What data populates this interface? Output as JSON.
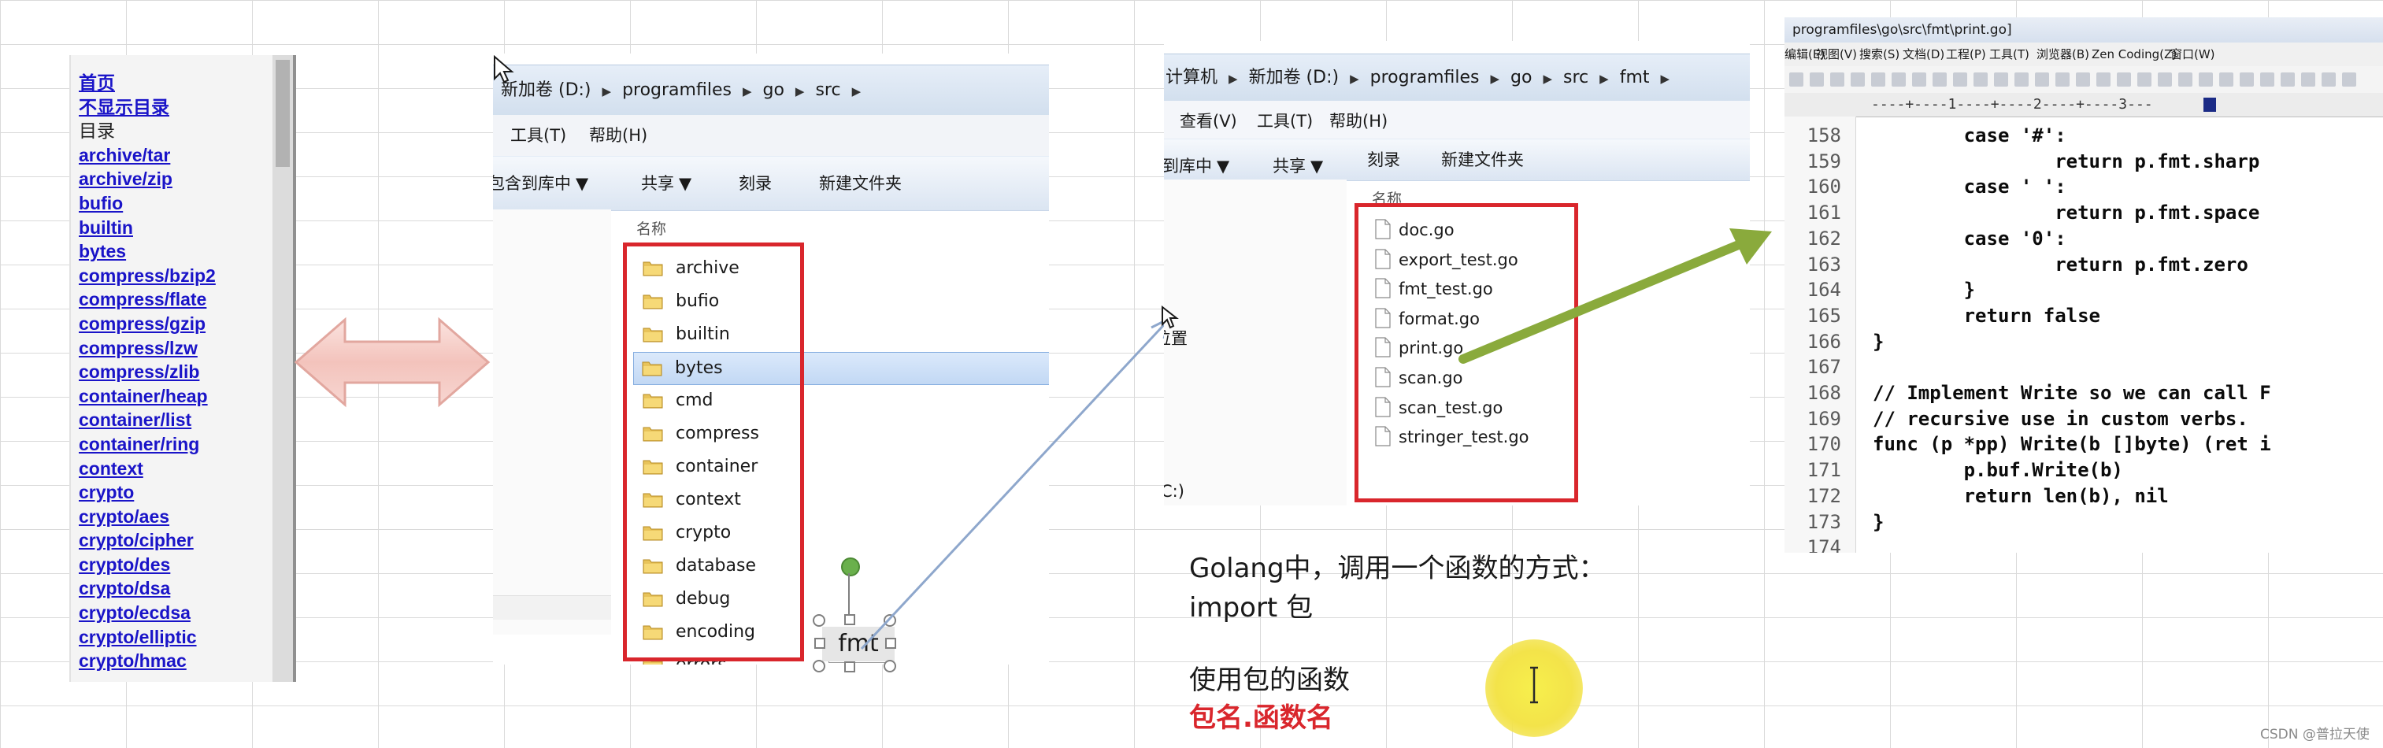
{
  "doc_index": {
    "items": [
      {
        "label": "首页",
        "link": true
      },
      {
        "label": "不显示目录",
        "link": true
      },
      {
        "label": "目录",
        "link": false
      },
      {
        "label": "archive/tar",
        "link": true
      },
      {
        "label": "archive/zip",
        "link": true
      },
      {
        "label": "bufio",
        "link": true
      },
      {
        "label": "builtin",
        "link": true
      },
      {
        "label": "bytes",
        "link": true
      },
      {
        "label": "compress/bzip2",
        "link": true
      },
      {
        "label": "compress/flate",
        "link": true
      },
      {
        "label": "compress/gzip",
        "link": true
      },
      {
        "label": "compress/lzw",
        "link": true
      },
      {
        "label": "compress/zlib",
        "link": true
      },
      {
        "label": "container/heap",
        "link": true
      },
      {
        "label": "container/list",
        "link": true
      },
      {
        "label": "container/ring",
        "link": true
      },
      {
        "label": "context",
        "link": true
      },
      {
        "label": "crypto",
        "link": true
      },
      {
        "label": "crypto/aes",
        "link": true
      },
      {
        "label": "crypto/cipher",
        "link": true
      },
      {
        "label": "crypto/des",
        "link": true
      },
      {
        "label": "crypto/dsa",
        "link": true
      },
      {
        "label": "crypto/ecdsa",
        "link": true
      },
      {
        "label": "crypto/elliptic",
        "link": true
      },
      {
        "label": "crypto/hmac",
        "link": true
      }
    ]
  },
  "explorer1": {
    "breadcrumb": [
      "新加卷 (D:)",
      "programfiles",
      "go",
      "src"
    ],
    "menu": {
      "tools": "工具(T)",
      "help": "帮助(H)"
    },
    "toolbar": {
      "include_library": "包含到库中",
      "share": "共享",
      "burn": "刻录",
      "new_folder": "新建文件夹"
    },
    "column_name": "名称",
    "folders": [
      "archive",
      "bufio",
      "builtin",
      "bytes",
      "cmd",
      "compress",
      "container",
      "context",
      "crypto",
      "database",
      "debug",
      "encoding",
      "errors"
    ],
    "selected_folder": "bytes",
    "dragged_label": "fmt"
  },
  "explorer2": {
    "breadcrumb": [
      "计算机",
      "新加卷 (D:)",
      "programfiles",
      "go",
      "src",
      "fmt"
    ],
    "menu": {
      "view": "查看(V)",
      "tools": "工具(T)",
      "help": "帮助(H)"
    },
    "toolbar": {
      "include_library": "包含到库中",
      "share": "共享",
      "burn": "刻录",
      "new_folder": "新建文件夹"
    },
    "column_name": "名称",
    "nav_location": "位置",
    "nav_drive": "C:)",
    "files": [
      "doc.go",
      "export_test.go",
      "fmt_test.go",
      "format.go",
      "print.go",
      "scan.go",
      "scan_test.go",
      "stringer_test.go"
    ]
  },
  "editor": {
    "title": "programfiles\\go\\src\\fmt\\print.go]",
    "menu": [
      "编辑(E)",
      "视图(V)",
      "搜索(S)",
      "文档(D)",
      "工程(P)",
      "工具(T)",
      "浏览器(B)",
      "Zen Coding(Z)",
      "窗口(W)"
    ],
    "ruler": "----+----1----+----2----+----3---",
    "lines": [
      {
        "n": "158",
        "code": "        case '#':"
      },
      {
        "n": "159",
        "code": "                return p.fmt.sharp"
      },
      {
        "n": "160",
        "code": "        case ' ':"
      },
      {
        "n": "161",
        "code": "                return p.fmt.space"
      },
      {
        "n": "162",
        "code": "        case '0':"
      },
      {
        "n": "163",
        "code": "                return p.fmt.zero"
      },
      {
        "n": "164",
        "code": "        }"
      },
      {
        "n": "165",
        "code": "        return false"
      },
      {
        "n": "166",
        "code": "}"
      },
      {
        "n": "167",
        "code": ""
      },
      {
        "n": "168",
        "code": "// Implement Write so we can call F"
      },
      {
        "n": "169",
        "code": "// recursive use in custom verbs."
      },
      {
        "n": "170",
        "code": "func (p *pp) Write(b []byte) (ret i"
      },
      {
        "n": "171",
        "code": "        p.buf.Write(b)"
      },
      {
        "n": "172",
        "code": "        return len(b), nil"
      },
      {
        "n": "173",
        "code": "}"
      },
      {
        "n": "174",
        "code": ""
      }
    ]
  },
  "notes": {
    "line1": "Golang中，调用一个函数的方式：",
    "line2": "import  包",
    "line3": "使用包的函数",
    "line4": "包名.函数名"
  },
  "watermark": "CSDN @普拉天使",
  "colors": {
    "highlight_red": "#d9262c",
    "link_blue": "#1a14c8",
    "arrow_green": "#8aaa3c",
    "arrow_pink": "#f3c7c2",
    "cursor_yellow": "#f3e34a"
  }
}
